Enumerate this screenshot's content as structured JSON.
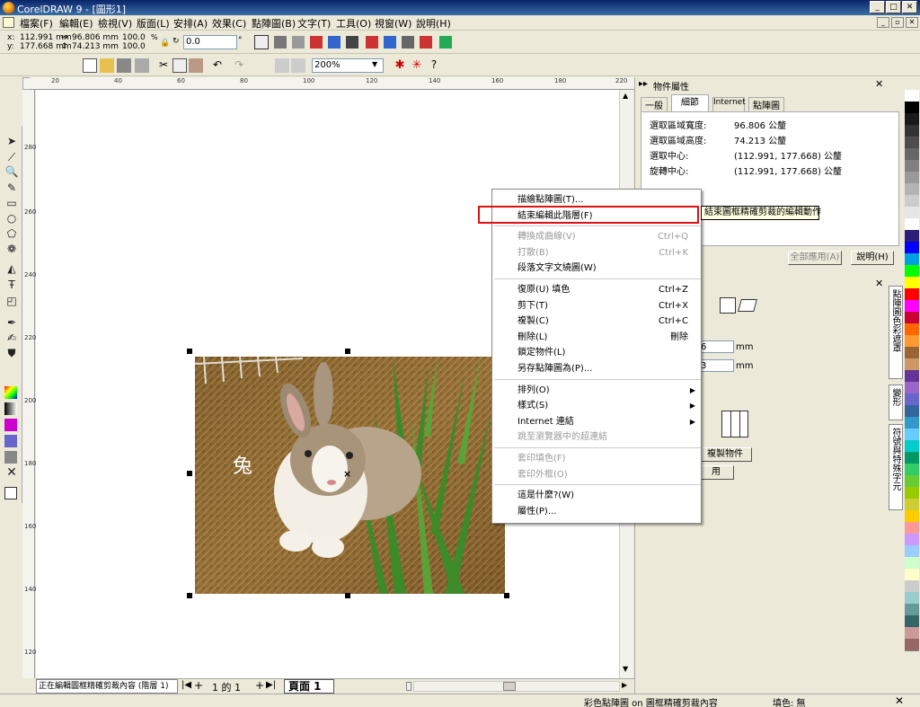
{
  "window": {
    "title": "CorelDRAW 9 - [圖形1]"
  },
  "menubar": [
    "檔案(F)",
    "編輯(E)",
    "檢視(V)",
    "版面(L)",
    "安排(A)",
    "效果(C)",
    "點陣圖(B)",
    "文字(T)",
    "工具(O)",
    "視窗(W)",
    "說明(H)"
  ],
  "propbar": {
    "x": "112.991 mm",
    "y": "177.668 mm",
    "w": "96.806 mm",
    "h": "74.213 mm",
    "sx": "100.0",
    "sy": "100.0",
    "rot": "0.0",
    "x_label": "x:",
    "y_label": "y:",
    "deg": "°"
  },
  "zoom": "200%",
  "rulers": {
    "h": [
      "20",
      "40",
      "60",
      "80",
      "100",
      "120",
      "140",
      "160",
      "180",
      "200",
      "220"
    ],
    "v": [
      "280",
      "260",
      "240",
      "220",
      "200",
      "180",
      "160",
      "140",
      "120"
    ]
  },
  "canvas": {
    "overlay_text": "兔"
  },
  "docker": {
    "title": "物件屬性",
    "tabs": [
      "一般",
      "細節",
      "Internet",
      "點陣圖"
    ],
    "rows": [
      {
        "label": "選取區域寬度:",
        "value": "96.806 公釐"
      },
      {
        "label": "選取區域高度:",
        "value": "74.213 公釐"
      },
      {
        "label": "選取中心:",
        "value": "(112.991, 177.668) 公釐"
      },
      {
        "label": "旋轉中心:",
        "value": "(112.991, 177.668) 公釐"
      }
    ],
    "apply_all": "全部應用(A)",
    "help": "說明(H)"
  },
  "docker2": {
    "val1": "6",
    "val2": "3",
    "unit": "mm",
    "btn1": "複製物件",
    "btn2": "用"
  },
  "vtabs": [
    "點陣圖色彩遮罩",
    "變形",
    "符號與特殊字元"
  ],
  "context_menu": [
    {
      "label": "描繪點陣圖(T)...",
      "shortcut": "",
      "disabled": false,
      "sub": false
    },
    {
      "label": "結束編輯此階層(F)",
      "shortcut": "",
      "disabled": false,
      "sub": false
    },
    {
      "sep": true
    },
    {
      "label": "轉換成曲線(V)",
      "shortcut": "Ctrl+Q",
      "disabled": true,
      "sub": false
    },
    {
      "label": "打散(B)",
      "shortcut": "Ctrl+K",
      "disabled": true,
      "sub": false
    },
    {
      "label": "段落文字文繞圖(W)",
      "shortcut": "",
      "disabled": false,
      "sub": false
    },
    {
      "sep": true
    },
    {
      "label": "復原(U) 填色",
      "shortcut": "Ctrl+Z",
      "disabled": false,
      "sub": false
    },
    {
      "label": "剪下(T)",
      "shortcut": "Ctrl+X",
      "disabled": false,
      "sub": false
    },
    {
      "label": "複製(C)",
      "shortcut": "Ctrl+C",
      "disabled": false,
      "sub": false
    },
    {
      "label": "刪除(L)",
      "shortcut": "刪除",
      "disabled": false,
      "sub": false
    },
    {
      "label": "鎖定物件(L)",
      "shortcut": "",
      "disabled": false,
      "sub": false
    },
    {
      "label": "另存點陣圖為(P)...",
      "shortcut": "",
      "disabled": false,
      "sub": false
    },
    {
      "sep": true
    },
    {
      "label": "排列(O)",
      "shortcut": "",
      "disabled": false,
      "sub": true
    },
    {
      "label": "樣式(S)",
      "shortcut": "",
      "disabled": false,
      "sub": true
    },
    {
      "label": "Internet 連結",
      "shortcut": "",
      "disabled": false,
      "sub": true
    },
    {
      "label": "跳至瀏覽器中的超連結",
      "shortcut": "",
      "disabled": true,
      "sub": false
    },
    {
      "sep": true
    },
    {
      "label": "套印填色(F)",
      "shortcut": "",
      "disabled": true,
      "sub": false
    },
    {
      "label": "套印外框(O)",
      "shortcut": "",
      "disabled": true,
      "sub": false
    },
    {
      "sep": true
    },
    {
      "label": "這是什麼?(W)",
      "shortcut": "",
      "disabled": false,
      "sub": false
    },
    {
      "label": "屬性(P)...",
      "shortcut": "",
      "disabled": false,
      "sub": false
    }
  ],
  "tooltip": "結束圖框精確剪裁的編輯動作",
  "pagenav": {
    "count": "1 的 1",
    "page_tab": "頁面 1",
    "layer_status": "正在編輯圖框精確剪裁內容 (階層 1)"
  },
  "status": {
    "object": "彩色點陣圖 on 圖框精確剪裁內容",
    "fill": "填色: 無"
  },
  "palette": [
    "#ffffff",
    "#000000",
    "#1a1a1a",
    "#333333",
    "#4d4d4d",
    "#666666",
    "#808080",
    "#999999",
    "#b3b3b3",
    "#cccccc",
    "#e6e6e6",
    "#ffffff",
    "#2b1f7a",
    "#0000ff",
    "#00a0e0",
    "#00ff00",
    "#ffff00",
    "#ff0000",
    "#ff00ff",
    "#cc0033",
    "#ff6600",
    "#ff9933",
    "#996633",
    "#cc9966",
    "#663399",
    "#9966cc",
    "#6666cc",
    "#336699",
    "#3399cc",
    "#66ccff",
    "#00cccc",
    "#009966",
    "#33cc66",
    "#66cc33",
    "#99cc00",
    "#cccc33",
    "#ffcc00",
    "#ff9999",
    "#cc99ff",
    "#99ccff",
    "#ccffcc",
    "#ffffcc",
    "#cccccc",
    "#99cccc",
    "#669999",
    "#336666",
    "#cc9999",
    "#996666"
  ]
}
